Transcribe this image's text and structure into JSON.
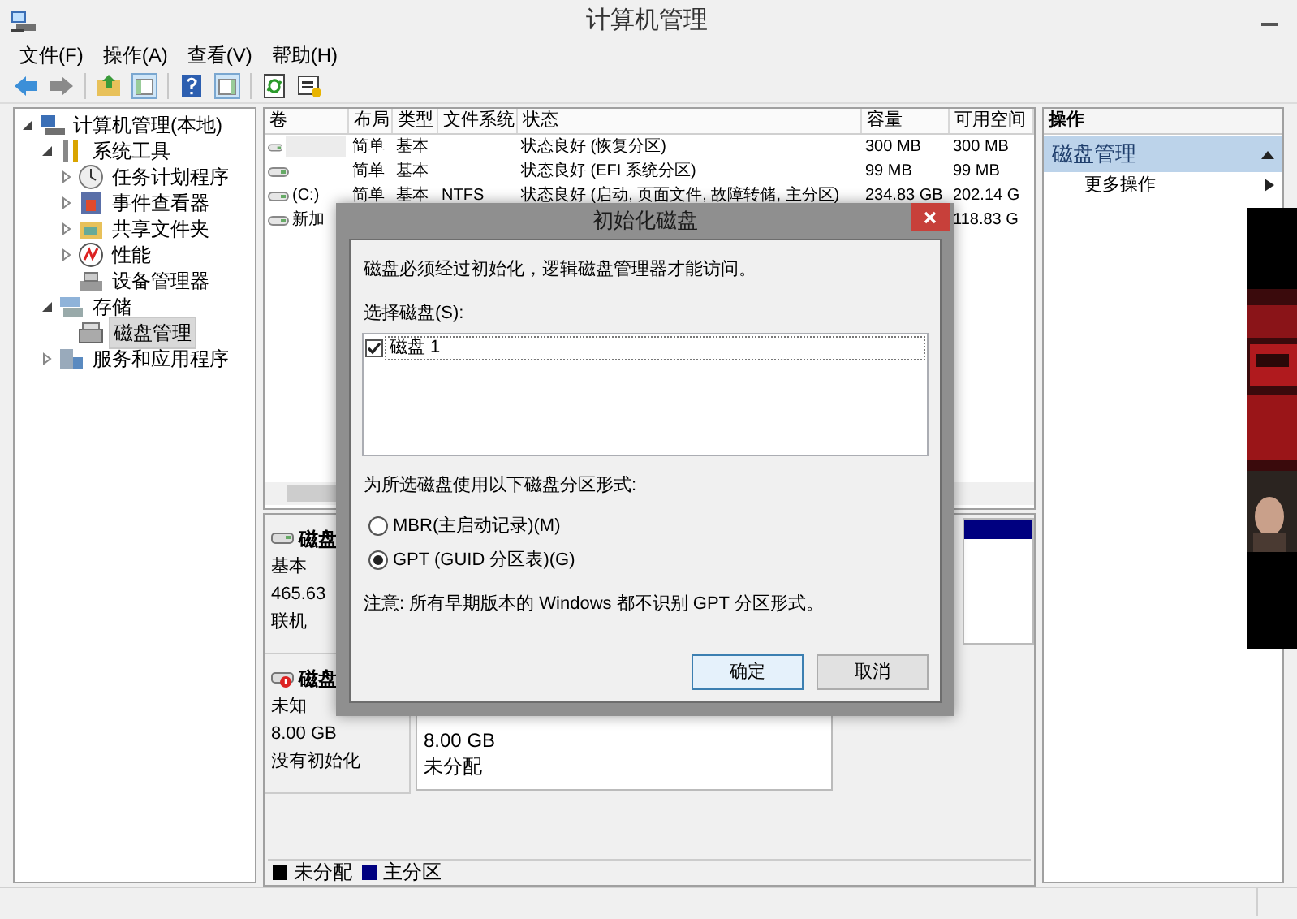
{
  "window": {
    "title": "计算机管理"
  },
  "menu": [
    "文件(F)",
    "操作(A)",
    "查看(V)",
    "帮助(H)"
  ],
  "tree": [
    {
      "label": "计算机管理(本地)",
      "expanded": true,
      "selected": false,
      "children": [
        {
          "label": "系统工具",
          "expanded": true,
          "selected": false,
          "children": [
            {
              "label": "任务计划程序",
              "expanded": false,
              "selected": false
            },
            {
              "label": "事件查看器",
              "expanded": false,
              "selected": false
            },
            {
              "label": "共享文件夹",
              "expanded": false,
              "selected": false
            },
            {
              "label": "性能",
              "expanded": false,
              "selected": false
            },
            {
              "label": "设备管理器",
              "selected": false
            }
          ]
        },
        {
          "label": "存储",
          "expanded": true,
          "selected": false,
          "children": [
            {
              "label": "磁盘管理",
              "selected": true
            }
          ]
        },
        {
          "label": "服务和应用程序",
          "expanded": false,
          "selected": false
        }
      ]
    }
  ],
  "volumes": {
    "columns": [
      "卷",
      "布局",
      "类型",
      "文件系统",
      "状态",
      "容量",
      "可用空间"
    ],
    "rows": [
      {
        "layout": "简单",
        "type": "基本",
        "status": "状态良好 (恢复分区)",
        "capacity": "300 MB",
        "free": "300 MB",
        "masked": true
      },
      {
        "layout": "简单",
        "type": "基本",
        "status": "状态良好 (EFI 系统分区)",
        "capacity": "99 MB",
        "free": "99 MB",
        "masked": false
      },
      {
        "volume": "(C:)",
        "layout": "简单",
        "type": "基本",
        "filesystem": "NTFS",
        "status": "状态良好 (启动, 页面文件, 故障转储, 主分区)",
        "capacity": "234.83 GB",
        "free": "202.14 G",
        "masked": false
      },
      {
        "volume": "新加",
        "free": "118.83 G",
        "masked": false
      }
    ]
  },
  "disks": [
    {
      "name": "磁盘",
      "type": "基本",
      "size": "465.63",
      "status": "联机",
      "initialized": true
    },
    {
      "name": "磁盘",
      "type": "未知",
      "size": "8.00 GB",
      "status": "没有初始化",
      "initialized": false,
      "partition": {
        "size": "8.00 GB",
        "state": "未分配"
      }
    }
  ],
  "legend": [
    {
      "label": "未分配",
      "color": "#000000"
    },
    {
      "label": "主分区",
      "color": "#000080"
    }
  ],
  "actions": {
    "header": "操作",
    "section": "磁盘管理",
    "expanded": true,
    "items": [
      "更多操作"
    ]
  },
  "dialog": {
    "title": "初始化磁盘",
    "message": "磁盘必须经过初始化，逻辑磁盘管理器才能访问。",
    "select_label": "选择磁盘(S):",
    "disks": [
      {
        "label": "磁盘 1",
        "checked": true
      }
    ],
    "style_label": "为所选磁盘使用以下磁盘分区形式:",
    "options": [
      {
        "label": "MBR(主启动记录)(M)",
        "selected": false
      },
      {
        "label": "GPT (GUID 分区表)(G)",
        "selected": true
      }
    ],
    "note": "注意: 所有早期版本的 Windows 都不识别 GPT 分区形式。",
    "buttons": [
      {
        "label": "确定",
        "default": true
      },
      {
        "label": "取消",
        "default": false
      }
    ]
  },
  "overlay": {
    "kind": "picture"
  }
}
